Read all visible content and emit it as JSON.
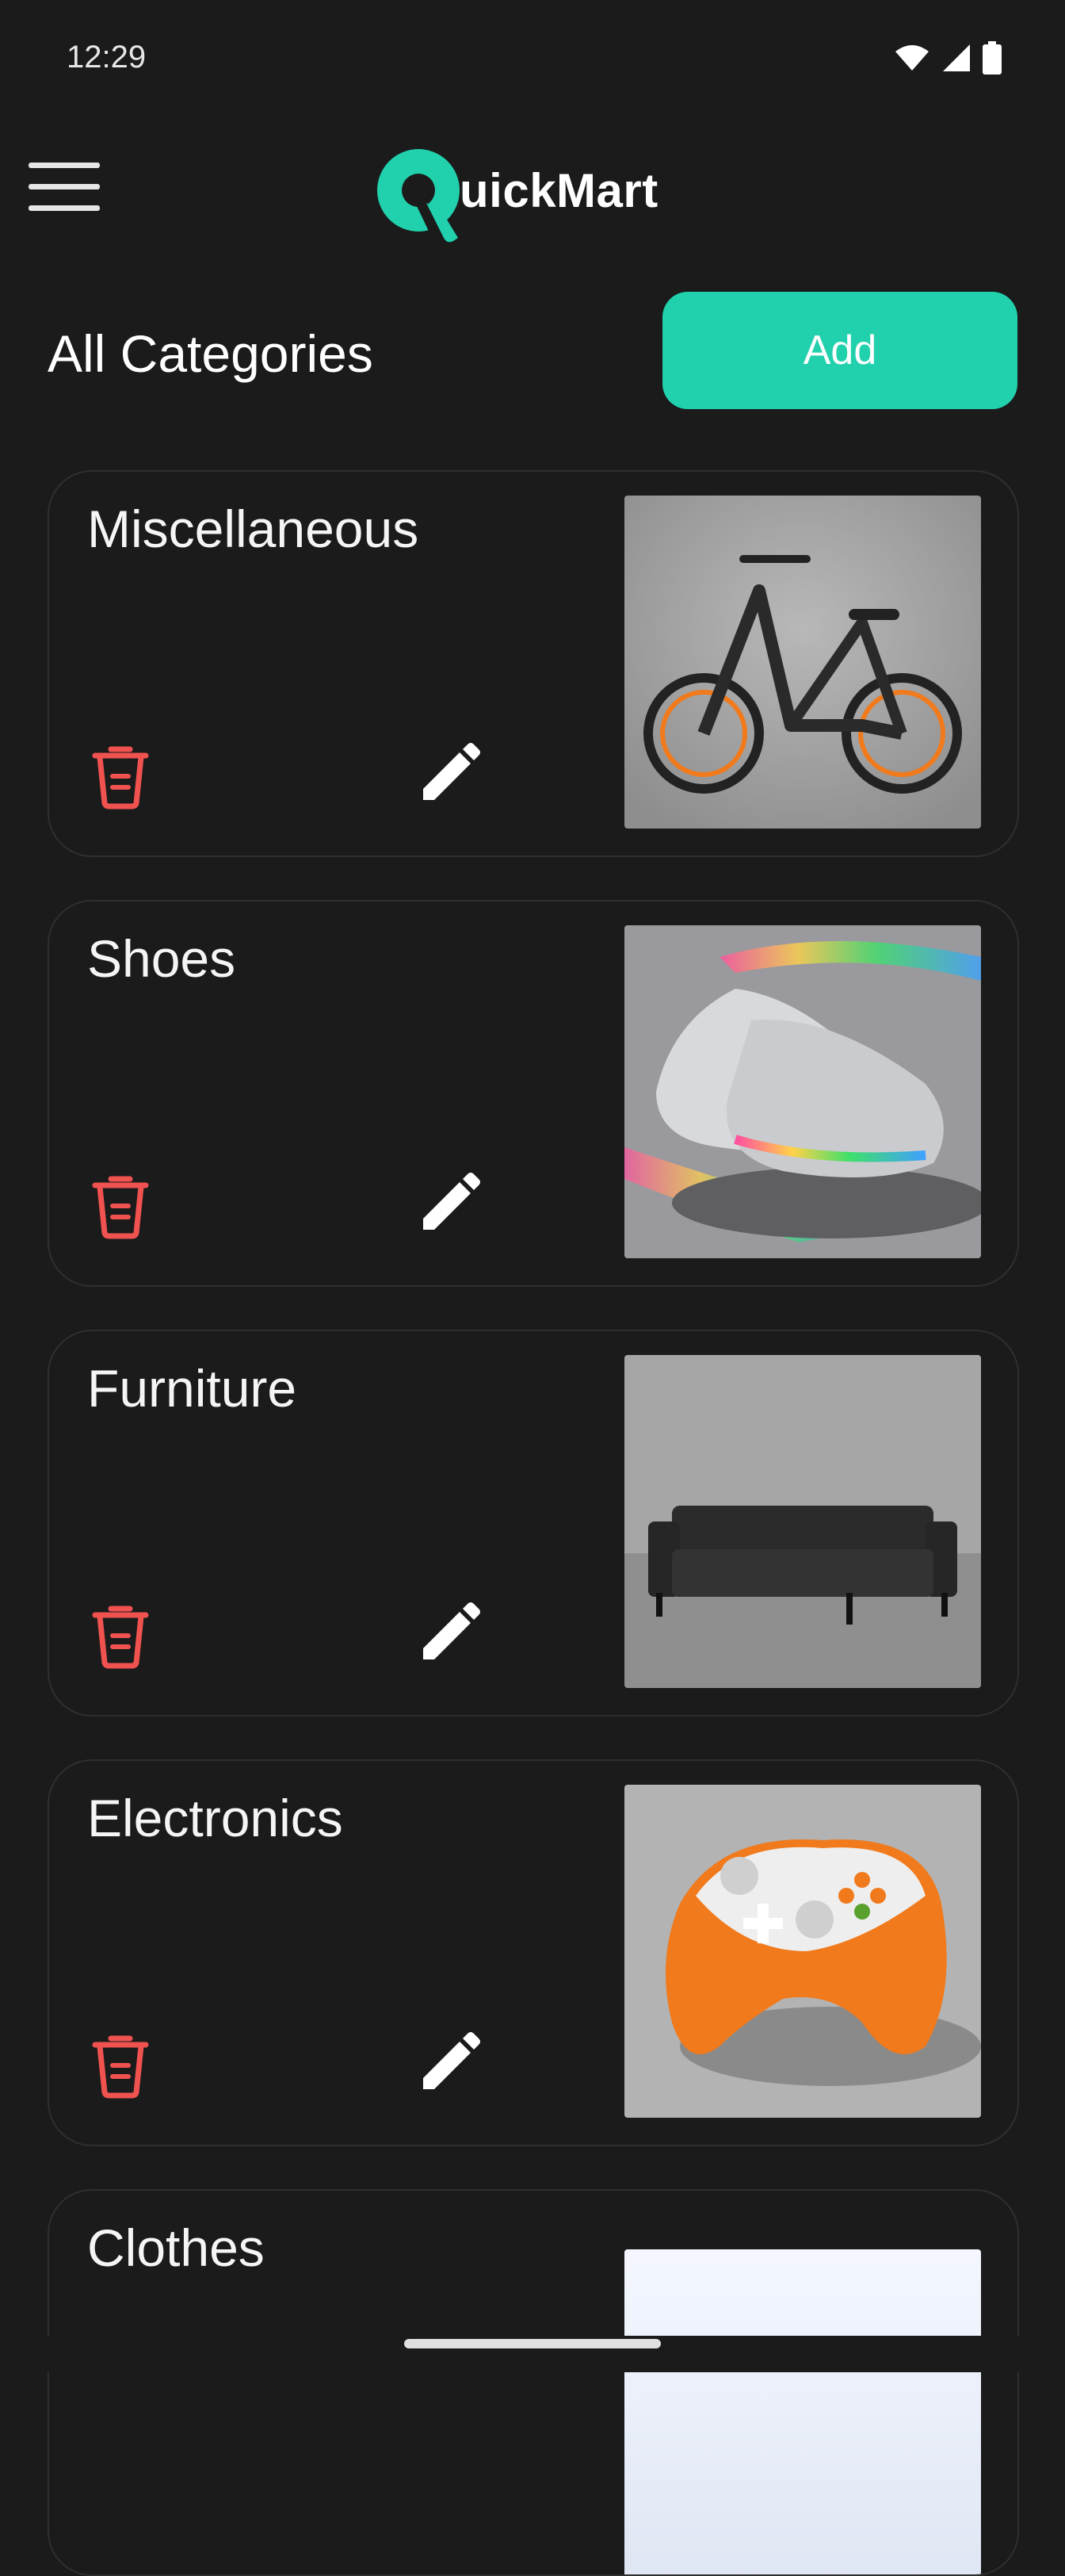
{
  "status_bar": {
    "time": "12:29",
    "icons": [
      "wifi-icon",
      "signal-icon",
      "battery-icon"
    ]
  },
  "app_bar": {
    "brand": "uickMart",
    "brand_letter": "Q",
    "brand_color": "#21d1ad"
  },
  "header": {
    "title": "All Categories",
    "add_label": "Add"
  },
  "categories": [
    {
      "name": "Miscellaneous",
      "image": "bicycle"
    },
    {
      "name": "Shoes",
      "image": "sneakers"
    },
    {
      "name": "Furniture",
      "image": "sofa"
    },
    {
      "name": "Electronics",
      "image": "game-controller"
    },
    {
      "name": "Clothes",
      "image": "clothes"
    }
  ],
  "colors": {
    "background": "#1b1b1b",
    "accent": "#21d1ad",
    "delete": "#f0524f"
  }
}
